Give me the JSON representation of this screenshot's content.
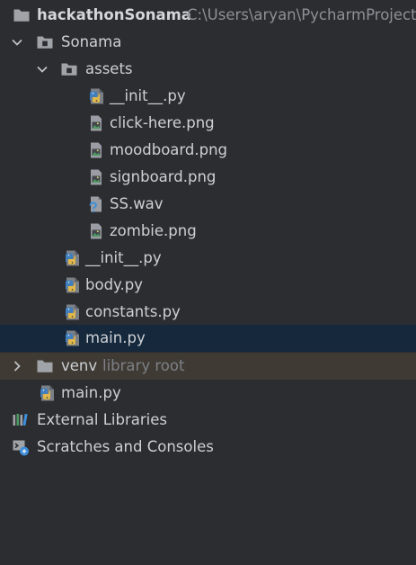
{
  "project": {
    "name": "hackathonSonama",
    "path": "C:\\Users\\aryan\\PycharmProjects\\hackathonSonama"
  },
  "tree": {
    "sonama": "Sonama",
    "assets": "assets",
    "assets_init": "__init__.py",
    "click_here": "click-here.png",
    "moodboard": "moodboard.png",
    "signboard": "signboard.png",
    "ss_wav": "SS.wav",
    "zombie": "zombie.png",
    "sonama_init": "__init__.py",
    "body": "body.py",
    "constants": "constants.py",
    "sonama_main": "main.py",
    "venv": "venv",
    "venv_hint": "library root",
    "root_main": "main.py",
    "external_libraries": "External Libraries",
    "scratches": "Scratches and Consoles"
  },
  "selected_item": "main.py",
  "colors": {
    "background": "#2b2d30",
    "selection": "#15283c",
    "excluded_row": "#3f3b34",
    "folder": "#a0a4a9",
    "text": "#cdd0d5",
    "muted_text": "#7d8087"
  },
  "icons": {
    "folder": "folder-icon",
    "module_folder": "module-folder-icon",
    "python_file": "python-file-icon",
    "image_file": "image-file-icon",
    "unknown_file": "unknown-file-icon",
    "libraries": "libraries-icon",
    "scratches": "scratches-icon"
  }
}
